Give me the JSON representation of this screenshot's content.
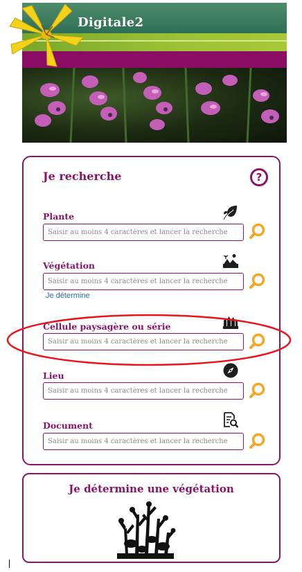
{
  "header": {
    "site_title": "Digitale2"
  },
  "search": {
    "title": "Je recherche",
    "help_icon": "help-circle-icon",
    "search_icon": "magnifier-icon",
    "fields": [
      {
        "key": "plante",
        "label": "Plante",
        "icon": "leaf-icon",
        "placeholder": "Saisir au moins 4 caractères et lancer la recherche"
      },
      {
        "key": "vegetation",
        "label": "Végétation",
        "icon": "landscape-icon",
        "placeholder": "Saisir au moins 4 caractères et lancer la recherche"
      },
      {
        "key": "cellule",
        "label": "Cellule paysagère ou série",
        "icon": "vegetation-series-icon",
        "placeholder": "Saisir au moins 4 caractères et lancer la recherche"
      },
      {
        "key": "lieu",
        "label": "Lieu",
        "icon": "compass-icon",
        "placeholder": "Saisir au moins 4 caractères et lancer la recherche"
      },
      {
        "key": "document",
        "label": "Document",
        "icon": "document-search-icon",
        "placeholder": "Saisir au moins 4 caractères et lancer la recherche"
      }
    ],
    "vegetation_link": "Je détermine"
  },
  "determine": {
    "title": "Je détermine une végétation",
    "image_icon": "vegetation-silhouette-icon"
  },
  "colors": {
    "brand_purple": "#8a1468",
    "accent_orange": "#f5a623",
    "link_blue": "#2b6aa8",
    "annotation_red": "#e8141c"
  }
}
